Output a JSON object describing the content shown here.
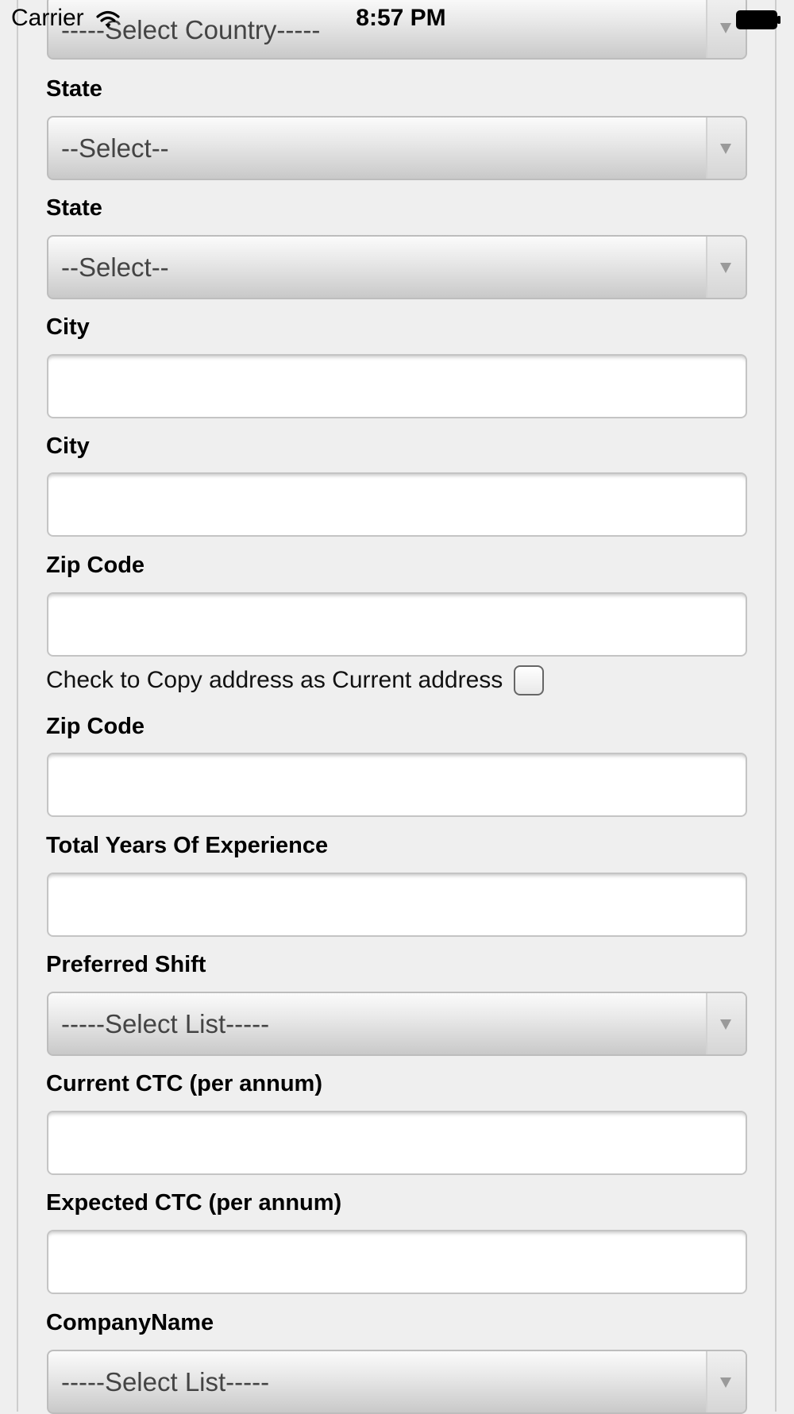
{
  "status_bar": {
    "carrier": "Carrier",
    "time": "8:57 PM",
    "wifi_icon": "wifi-icon",
    "battery_icon": "battery-icon"
  },
  "form": {
    "country_select": {
      "value": "-----Select Country-----"
    },
    "state_1": {
      "label": "State",
      "value": "--Select--"
    },
    "state_2": {
      "label": "State",
      "value": "--Select--"
    },
    "city_1": {
      "label": "City",
      "value": ""
    },
    "city_2": {
      "label": "City",
      "value": ""
    },
    "zip_1": {
      "label": "Zip Code",
      "value": ""
    },
    "copy_address": {
      "label": "Check to Copy address as Current address",
      "checked": false
    },
    "zip_2": {
      "label": "Zip Code",
      "value": ""
    },
    "experience": {
      "label": "Total Years Of Experience",
      "value": ""
    },
    "preferred_shift": {
      "label": "Preferred Shift",
      "value": "-----Select List-----"
    },
    "current_ctc": {
      "label": "Current CTC (per annum)",
      "value": ""
    },
    "expected_ctc": {
      "label": "Expected CTC (per annum)",
      "value": ""
    },
    "company_name": {
      "label": "CompanyName",
      "value": "-----Select List-----"
    }
  }
}
